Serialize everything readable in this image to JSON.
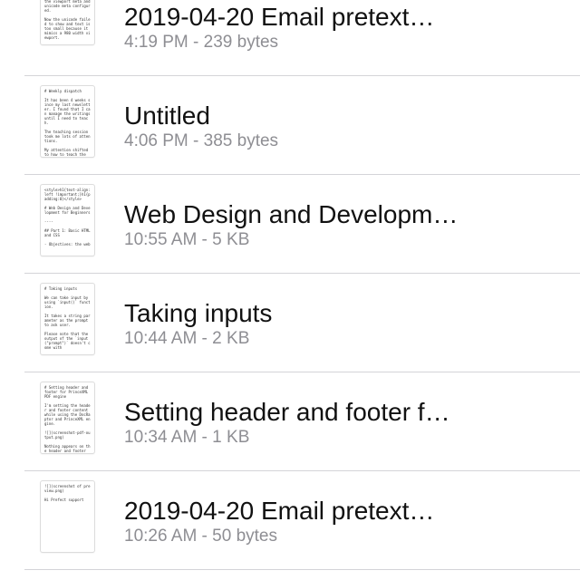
{
  "files": [
    {
      "title": "2019-04-20 Email pretext…",
      "time": "4:19 PM",
      "size": "239 bytes",
      "preview": "preview.png)\n\nYour app would be much useful in iPhone if the HTML preview has the viewport meta and unicode meta configured.\n\nNow the unicode failed to show and text is too small because it mimics a 980 width viewport."
    },
    {
      "title": "Untitled",
      "time": "4:06 PM",
      "size": "385 bytes",
      "preview": "# Weekly dispatch\n\nIt has been 4 weeks since my last newsletter. I found that I can manage the writings until I need to teach.\n\nThe teaching session took me lots of attentions.\n\nMy attention shifted to how to teach the"
    },
    {
      "title": "Web Design and Developm…",
      "time": "10:55 AM",
      "size": "5 KB",
      "preview": "<style>h1{text-align:left !important;}h1{padding:0}</style>\n\n# Web Design and Development for Beginners\n\n----\n\n## Part 1: Basic HTML and CSS\n\n- Objectives: the web"
    },
    {
      "title": "Taking inputs",
      "time": "10:44 AM",
      "size": "2 KB",
      "preview": "# Taking inputs\n\nWe can take input by using `input()` function.\n\nIt takes a string parameter as the prompt to ask user.\n\nPlease note that the output of the `input(\"prompt\")` doesn't come with"
    },
    {
      "title": "Setting header and footer f…",
      "time": "10:34 AM",
      "size": "1 KB",
      "preview": "# Setting header and footer for PrinceXML PDF engine\n\nI'm setting the header and footer content while using the DocRaptor and PrinceXML engine.\n\n![](screenshot-pdf-output.png)\n\nNothing appears on the header and footer"
    },
    {
      "title": "2019-04-20 Email pretext…",
      "time": "10:26 AM",
      "size": "50 bytes",
      "preview": "![](screenshot of preview.png)\n\nHi Prefect support"
    }
  ],
  "meta_separator": " - "
}
